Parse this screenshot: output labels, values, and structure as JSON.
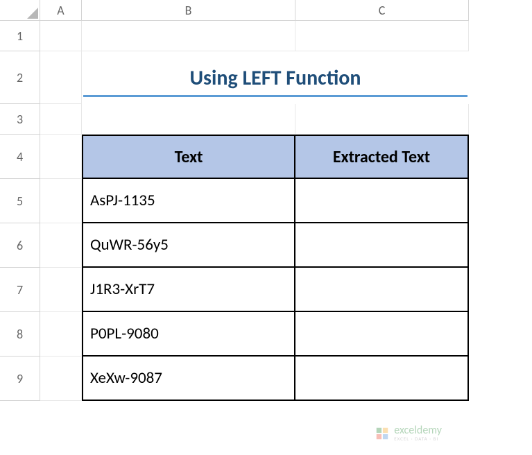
{
  "columns": [
    "A",
    "B",
    "C"
  ],
  "rows": [
    "1",
    "2",
    "3",
    "4",
    "5",
    "6",
    "7",
    "8",
    "9"
  ],
  "title": "Using LEFT Function",
  "table": {
    "headers": {
      "text": "Text",
      "extracted": "Extracted Text"
    },
    "data": [
      {
        "text": "AsPJ-1135",
        "extracted": ""
      },
      {
        "text": "QuWR-56y5",
        "extracted": ""
      },
      {
        "text": "J1R3-XrT7",
        "extracted": ""
      },
      {
        "text": "P0PL-9080",
        "extracted": ""
      },
      {
        "text": "XeXw-9087",
        "extracted": ""
      }
    ]
  },
  "watermark": {
    "brand": "exceldemy",
    "tagline": "EXCEL · DATA · BI"
  }
}
